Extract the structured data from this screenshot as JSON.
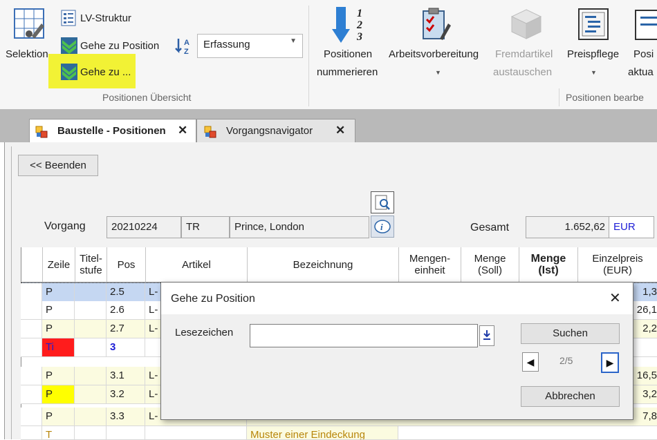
{
  "ribbon": {
    "selektion": "Selektion",
    "lv_struktur": "LV-Struktur",
    "gehe_zu_position": "Gehe zu Position",
    "gehe_zu": "Gehe zu ...",
    "sort_combo_value": "Erfassung",
    "group_uebersicht": "Positionen Übersicht",
    "positionen_nummerieren_l1": "Positionen",
    "positionen_nummerieren_l2": "nummerieren",
    "arbeitsvorbereitung": "Arbeitsvorbereitung",
    "fremdartikel_l1": "Fremdartikel",
    "fremdartikel_l2": "austauschen",
    "preispflege": "Preispflege",
    "pos_aktual_l1": "Posi",
    "pos_aktual_l2": "aktua",
    "group_bearbeiten": "Positionen bearbe",
    "highlight_color": "#f2f235"
  },
  "tabs": [
    {
      "label": "Baustelle - Positionen",
      "active": true
    },
    {
      "label": "Vorgangsnavigator",
      "active": false
    }
  ],
  "toolbar": {
    "beenden": "<< Beenden"
  },
  "vorgang": {
    "label": "Vorgang",
    "nummer": "20210224",
    "kuerzel": "TR",
    "kunde": "Prince, London",
    "gesamt_label": "Gesamt",
    "gesamt_value": "1.652,62",
    "waehrung": "EUR"
  },
  "table": {
    "headers": {
      "zeile": "Zeile",
      "titel_l1": "Titel-",
      "titel_l2": "stufe",
      "pos": "Pos",
      "artikel": "Artikel",
      "bezeichnung": "Bezeichnung",
      "me_l1": "Mengen-",
      "me_l2": "einheit",
      "soll_l1": "Menge",
      "soll_l2": "(Soll)",
      "ist_l1": "Menge",
      "ist_l2": "(Ist)",
      "ep_l1": "Einzelpreis",
      "ep_l2": "(EUR)"
    },
    "rows": [
      {
        "zeile": "P",
        "pos": "2.5",
        "artikel": "L-",
        "ep": "1,3"
      },
      {
        "zeile": "P",
        "pos": "2.6",
        "artikel": "L-",
        "ep": "26,1"
      },
      {
        "zeile": "P",
        "pos": "2.7",
        "artikel": "L-",
        "ep": "2,2"
      },
      {
        "zeile": "Ti",
        "pos": "3",
        "artikel": "",
        "ep": ""
      },
      {
        "zeile": "P",
        "pos": "3.1",
        "artikel": "L-",
        "ep": "16,5"
      },
      {
        "zeile": "P",
        "pos": "3.2",
        "artikel": "L-",
        "ep": "3,2"
      },
      {
        "zeile": "P",
        "pos": "3.3",
        "artikel": "L-",
        "ep": "7,8"
      },
      {
        "zeile": "T",
        "pos": "",
        "artikel": "",
        "bezeichnung": "Muster einer Eindeckung",
        "ep": ""
      }
    ],
    "colors": {
      "selected": "#c5d7f2",
      "alt": "#fbfbe0",
      "title_red": "#ff1c1c",
      "yellow": "#ffff00",
      "title_blue": "#1c1cd6"
    }
  },
  "dialog": {
    "title": "Gehe zu Position",
    "lesezeichen_label": "Lesezeichen",
    "lesezeichen_value": "",
    "suchen": "Suchen",
    "counter": "2/5",
    "abbrechen": "Abbrechen"
  }
}
